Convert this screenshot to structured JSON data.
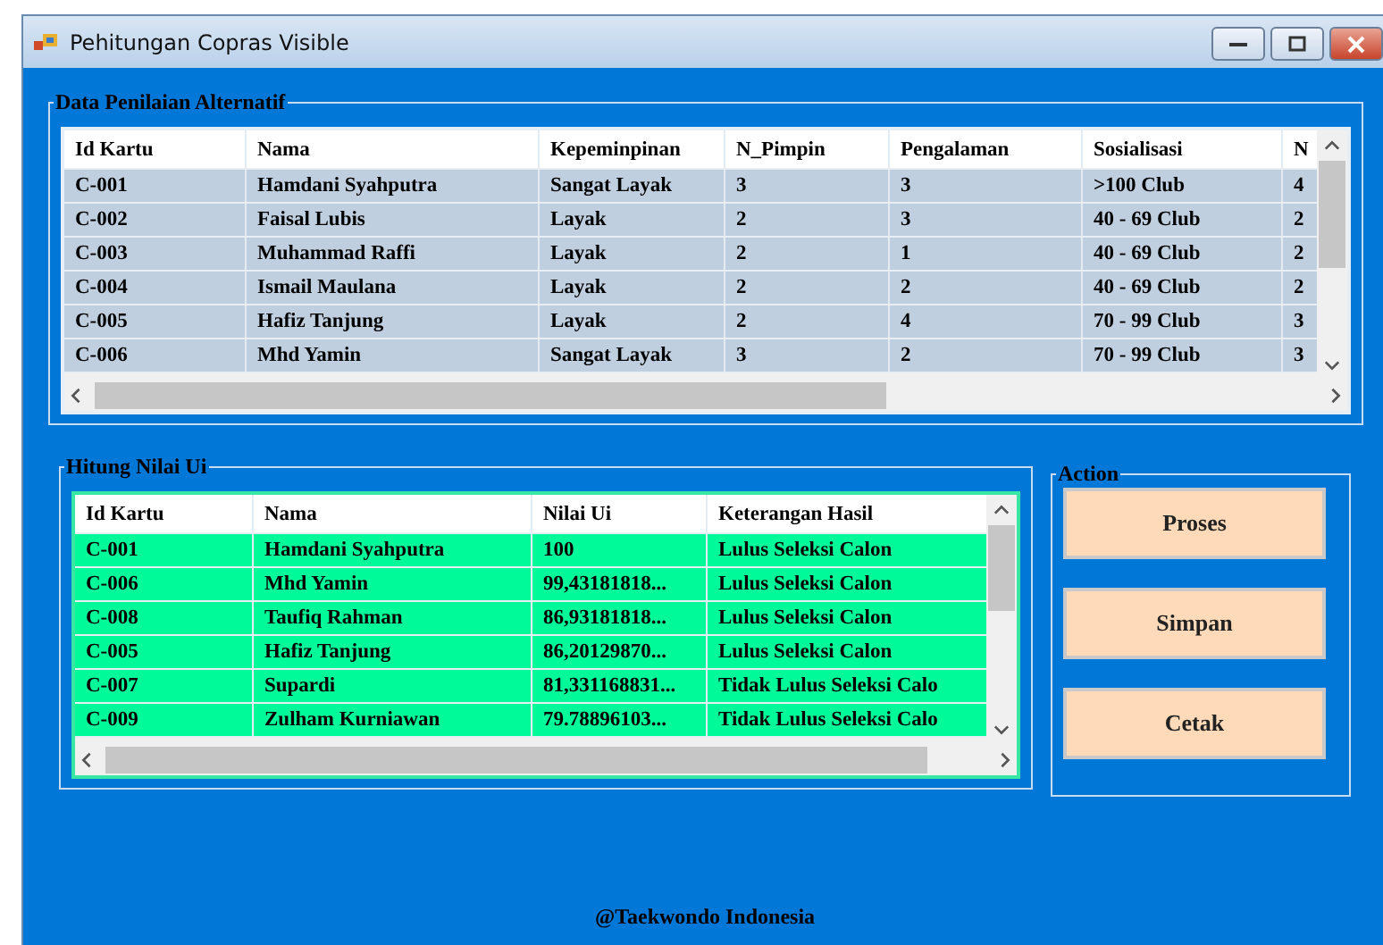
{
  "window": {
    "title": "Pehitungan Copras Visible"
  },
  "data_group": {
    "title": "Data Penilaian Alternatif",
    "columns": [
      "Id Kartu",
      "Nama",
      "Kepeminpinan",
      "N_Pimpin",
      "Pengalaman",
      "Sosialisasi",
      "N"
    ],
    "rows": [
      [
        "C-001",
        "Hamdani Syahputra",
        "Sangat Layak",
        "3",
        "3",
        ">100 Club",
        "4"
      ],
      [
        "C-002",
        "Faisal Lubis",
        "Layak",
        "2",
        "3",
        "40 - 69 Club",
        "2"
      ],
      [
        "C-003",
        "Muhammad Raffi",
        "Layak",
        "2",
        "1",
        "40 - 69 Club",
        "2"
      ],
      [
        "C-004",
        "Ismail Maulana",
        "Layak",
        "2",
        "2",
        "40 - 69 Club",
        "2"
      ],
      [
        "C-005",
        "Hafiz Tanjung",
        "Layak",
        "2",
        "4",
        "70 - 99 Club",
        "3"
      ],
      [
        "C-006",
        "Mhd Yamin",
        "Sangat Layak",
        "3",
        "2",
        "70 - 99 Club",
        "3"
      ]
    ]
  },
  "result_group": {
    "title": "Hitung Nilai Ui",
    "columns": [
      "Id Kartu",
      "Nama",
      "Nilai Ui",
      "Keterangan Hasil"
    ],
    "rows": [
      [
        "C-001",
        "Hamdani Syahputra",
        "100",
        "Lulus Seleksi Calon"
      ],
      [
        "C-006",
        "Mhd Yamin",
        "99,43181818...",
        "Lulus Seleksi Calon"
      ],
      [
        "C-008",
        "Taufiq Rahman",
        "86,93181818...",
        "Lulus Seleksi Calon"
      ],
      [
        "C-005",
        "Hafiz Tanjung",
        "86,20129870...",
        "Lulus Seleksi Calon"
      ],
      [
        "C-007",
        "Supardi",
        "81,331168831...",
        "Tidak Lulus Seleksi Calo"
      ],
      [
        "C-009",
        "Zulham Kurniawan",
        "79.78896103...",
        "Tidak Lulus Seleksi Calo"
      ]
    ]
  },
  "action_group": {
    "title": "Action",
    "buttons": [
      "Proses",
      "Simpan",
      "Cetak"
    ]
  },
  "footer": "@Taekwondo Indonesia"
}
